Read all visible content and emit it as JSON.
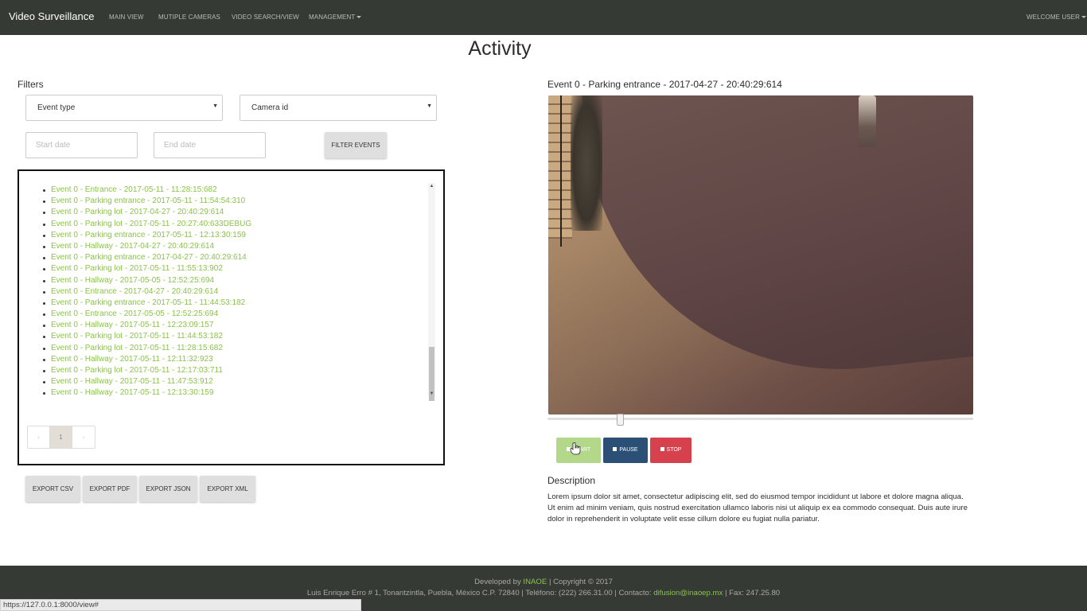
{
  "navbar": {
    "brand": "Video Surveillance",
    "links": [
      "MAIN VIEW",
      "MUTIPLE CAMERAS",
      "VIDEO SEARCH/VIEW",
      "MANAGEMENT"
    ],
    "user": "WELCOME USER"
  },
  "page": {
    "title": "Activity"
  },
  "filters": {
    "label": "Filters",
    "event_type": "Event type",
    "camera_id": "Camera id",
    "start_date_placeholder": "Start date",
    "end_date_placeholder": "End date",
    "filter_button": "FILTER EVENTS"
  },
  "events": [
    "Event 0 - Entrance - 2017-05-11 - 11:28:15:682",
    "Event 0 - Parking entrance - 2017-05-11 - 11:54:54:310",
    "Event 0 - Parking lot - 2017-04-27 - 20:40:29:614",
    "Event 0 - Parking lot - 2017-05-11 - 20:27:40:633DEBUG",
    "Event 0 - Parking entrance - 2017-05-11 - 12:13:30:159",
    "Event 0 - Hallway - 2017-04-27 - 20:40:29:614",
    "Event 0 - Parking entrance - 2017-04-27 - 20:40:29:614",
    "Event 0 - Parking lot - 2017-05-11 - 11:55:13:902",
    "Event 0 - Hallway - 2017-05-05 - 12:52:25:694",
    "Event 0 - Entrance - 2017-04-27 - 20:40:29:614",
    "Event 0 - Parking entrance - 2017-05-11 - 11:44:53:182",
    "Event 0 - Entrance - 2017-05-05 - 12:52:25:694",
    "Event 0 - Hallway - 2017-05-11 - 12:23:09:157",
    "Event 0 - Parking lot - 2017-05-11 - 11:44:53:182",
    "Event 0 - Parking lot - 2017-05-11 - 11:28:15:682",
    "Event 0 - Hallway - 2017-05-11 - 12:11:32:923",
    "Event 0 - Parking lot - 2017-05-11 - 12:17:03:711",
    "Event 0 - Hallway - 2017-05-11 - 11:47:53:912",
    "Event 0 - Hallway - 2017-05-11 - 12:13:30:159"
  ],
  "pagination": {
    "prev": "‹",
    "current": "1",
    "next": "›"
  },
  "exports": [
    "EXPORT CSV",
    "EXPORT PDF",
    "EXPORT JSON",
    "EXPORT XML"
  ],
  "video": {
    "title": "Event 0 - Parking entrance - 2017-04-27 - 20:40:29:614",
    "playback_position": 0.17,
    "controls": {
      "start": "START",
      "pause": "PAUSE",
      "stop": "STOP"
    }
  },
  "description": {
    "title": "Description",
    "text": "Lorem ipsum dolor sit amet, consectetur adipiscing elit, sed do eiusmod tempor incididunt ut labore et dolore magna aliqua. Ut enim ad minim veniam, quis nostrud exercitation ullamco laboris nisi ut aliquip ex ea commodo consequat. Duis aute irure dolor in reprehenderit in voluptate velit esse cillum dolore eu fugiat nulla pariatur."
  },
  "footer": {
    "developed_prefix": "Developed by ",
    "developer": "INAOE",
    "copyright": " | Copyright © 2017",
    "address": "Luis Enrique Erro # 1, Tonantzintla, Puebla, México C.P. 72840 | Teléfono: (222) 266.31.00 | Contacto: ",
    "email": "difusion@inaoep.mx",
    "fax": " | Fax: 247.25.80"
  },
  "status_bar": {
    "url": "https://127.0.0.1:8000/view#"
  },
  "colors": {
    "navbar_bg": "#363a35",
    "event_link": "#8bc34a",
    "start_button": "#b4d88a",
    "pause_button": "#2b4f75",
    "stop_button": "#d7414d"
  }
}
